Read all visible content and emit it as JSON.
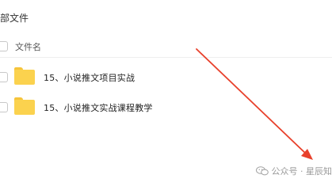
{
  "breadcrumb": {
    "text": "部文件"
  },
  "table": {
    "name_header": "文件名"
  },
  "files": [
    {
      "name": "15、小说推文项目实战",
      "icon": "folder-icon"
    },
    {
      "name": "15、小说推文实战课程教学",
      "icon": "folder-icon"
    }
  ],
  "annotation": {
    "arrow_color": "#e8412c"
  },
  "watermark": {
    "icon": "wechat-icon",
    "text": "公众号 · 星辰知"
  },
  "colors": {
    "folder": "#fbd24e",
    "folder_tab": "#f6c43a"
  }
}
